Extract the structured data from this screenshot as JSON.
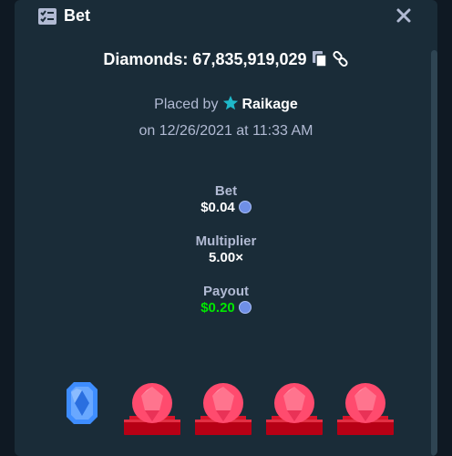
{
  "header": {
    "title": "Bet"
  },
  "diamonds": {
    "title": "Diamonds: 67,835,919,029"
  },
  "placed": {
    "prefix": "Placed by",
    "username": "Raikage",
    "date": "on 12/26/2021 at 11:33 AM"
  },
  "stats": {
    "bet_label": "Bet",
    "bet_value": "$0.04",
    "multiplier_label": "Multiplier",
    "multiplier_value": "5.00×",
    "payout_label": "Payout",
    "payout_value": "$0.20"
  },
  "colors": {
    "payout": "#00e701",
    "gem_blue": "#3e8dff",
    "gem_red": "#ff4b6e",
    "pedestal": "#b70015"
  },
  "gems": [
    "blue-gem",
    "red-gem",
    "red-gem",
    "red-gem",
    "red-gem"
  ]
}
